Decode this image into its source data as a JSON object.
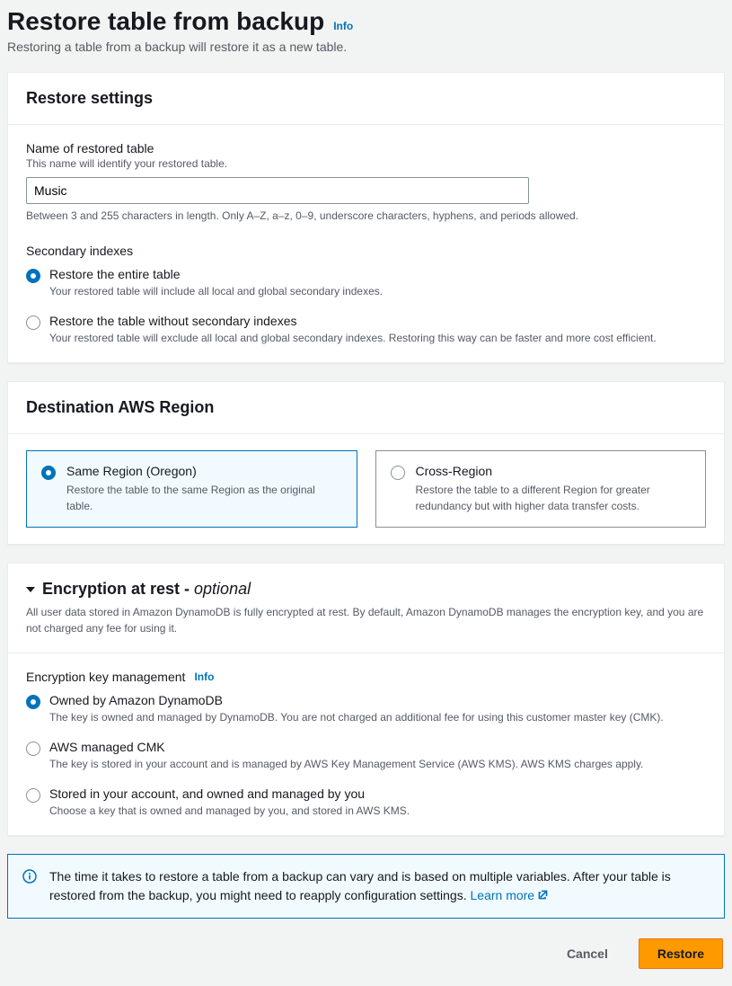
{
  "header": {
    "title": "Restore table from backup",
    "info": "Info",
    "subtitle": "Restoring a table from a backup will restore it as a new table."
  },
  "restore_settings": {
    "panel_title": "Restore settings",
    "name_label": "Name of restored table",
    "name_hint": "This name will identify your restored table.",
    "name_value": "Music",
    "name_helper": "Between 3 and 255 characters in length. Only A–Z, a–z, 0–9, underscore characters, hyphens, and periods allowed.",
    "secondary_indexes_label": "Secondary indexes",
    "secondary_options": [
      {
        "title": "Restore the entire table",
        "desc": "Your restored table will include all local and global secondary indexes.",
        "selected": true
      },
      {
        "title": "Restore the table without secondary indexes",
        "desc": "Your restored table will exclude all local and global secondary indexes. Restoring this way can be faster and more cost efficient.",
        "selected": false
      }
    ]
  },
  "destination_region": {
    "panel_title": "Destination AWS Region",
    "tiles": [
      {
        "title": "Same Region (Oregon)",
        "desc": "Restore the table to the same Region as the original table.",
        "selected": true
      },
      {
        "title": "Cross-Region",
        "desc": "Restore the table to a different Region for greater redundancy but with higher data transfer costs.",
        "selected": false
      }
    ]
  },
  "encryption": {
    "panel_title": "Encryption at rest - ",
    "optional": "optional",
    "panel_sub": "All user data stored in Amazon DynamoDB is fully encrypted at rest. By default, Amazon DynamoDB manages the encryption key, and you are not charged any fee for using it.",
    "key_mgmt_label": "Encryption key management",
    "info": "Info",
    "options": [
      {
        "title": "Owned by Amazon DynamoDB",
        "desc": "The key is owned and managed by DynamoDB. You are not charged an additional fee for using this customer master key (CMK).",
        "selected": true
      },
      {
        "title": "AWS managed CMK",
        "desc": "The key is stored in your account and is managed by AWS Key Management Service (AWS KMS). AWS KMS charges apply.",
        "selected": false
      },
      {
        "title": "Stored in your account, and owned and managed by you",
        "desc": "Choose a key that is owned and managed by you, and stored in AWS KMS.",
        "selected": false
      }
    ]
  },
  "info_box": {
    "text": "The time it takes to restore a table from a backup can vary and is based on multiple variables. After your table is restored from the backup, you might need to reapply configuration settings. ",
    "learn_more": "Learn more"
  },
  "actions": {
    "cancel": "Cancel",
    "restore": "Restore"
  }
}
